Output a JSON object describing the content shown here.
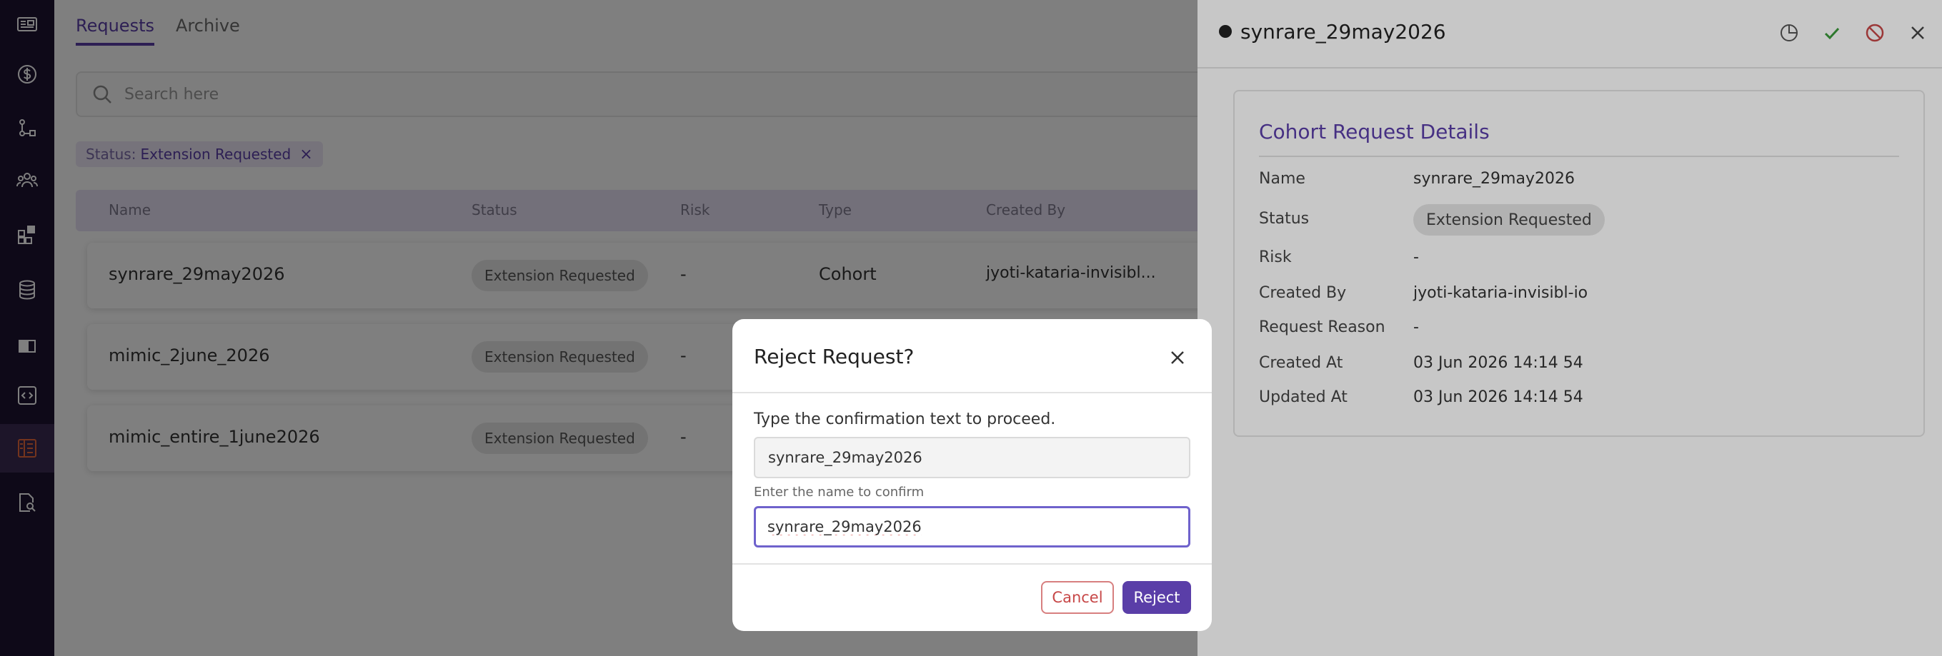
{
  "sidebar": {
    "items": [
      {
        "icon": "news-icon"
      },
      {
        "icon": "dollar-icon"
      },
      {
        "icon": "pipeline-icon"
      },
      {
        "icon": "users-icon"
      },
      {
        "icon": "apps-icon"
      },
      {
        "icon": "database-icon"
      },
      {
        "icon": "book-icon"
      },
      {
        "icon": "code-icon"
      },
      {
        "icon": "requests-icon",
        "active": true
      },
      {
        "icon": "file-search-icon"
      }
    ]
  },
  "main": {
    "tabs": [
      "Requests",
      "Archive"
    ],
    "search_placeholder": "Search here",
    "filter": {
      "key": "Status:",
      "value": "Extension Requested"
    },
    "table": {
      "columns": [
        "Name",
        "Status",
        "Risk",
        "Type",
        "Created By"
      ],
      "rows": [
        {
          "name": "synrare_29may2026",
          "status": "Extension Requested",
          "risk": "-",
          "type": "Cohort",
          "created_by": "jyoti-kataria-invisibl..."
        },
        {
          "name": "mimic_2june_2026",
          "status": "Extension Requested",
          "risk": "-",
          "type": "",
          "created_by": ""
        },
        {
          "name": "mimic_entire_1june2026",
          "status": "Extension Requested",
          "risk": "-",
          "type": "",
          "created_by": ""
        }
      ]
    }
  },
  "drawer": {
    "title": "synrare_29may2026",
    "details_title": "Cohort Request Details",
    "fields": [
      {
        "label": "Name",
        "value": "synrare_29may2026"
      },
      {
        "label": "Status",
        "value": "Extension Requested"
      },
      {
        "label": "Risk",
        "value": "-"
      },
      {
        "label": "Created By",
        "value": "jyoti-kataria-invisibl-io"
      },
      {
        "label": "Request Reason",
        "value": "-"
      },
      {
        "label": "Created At",
        "value": "03 Jun 2026 14:14 54"
      },
      {
        "label": "Updated At",
        "value": "03 Jun 2026 14:14 54"
      }
    ]
  },
  "modal": {
    "title": "Reject Request?",
    "prompt": "Type the confirmation text to proceed.",
    "confirm_text": "synrare_29may2026",
    "helper": "Enter the name to confirm",
    "input_value": "synrare_29may2026",
    "cancel_label": "Cancel",
    "reject_label": "Reject"
  },
  "colors": {
    "sidebar_bg": "#1c1230",
    "accent": "#5a3ea8",
    "active_icon": "#e8693a",
    "cancel": "#c74747",
    "approve": "#3a9a3a"
  }
}
